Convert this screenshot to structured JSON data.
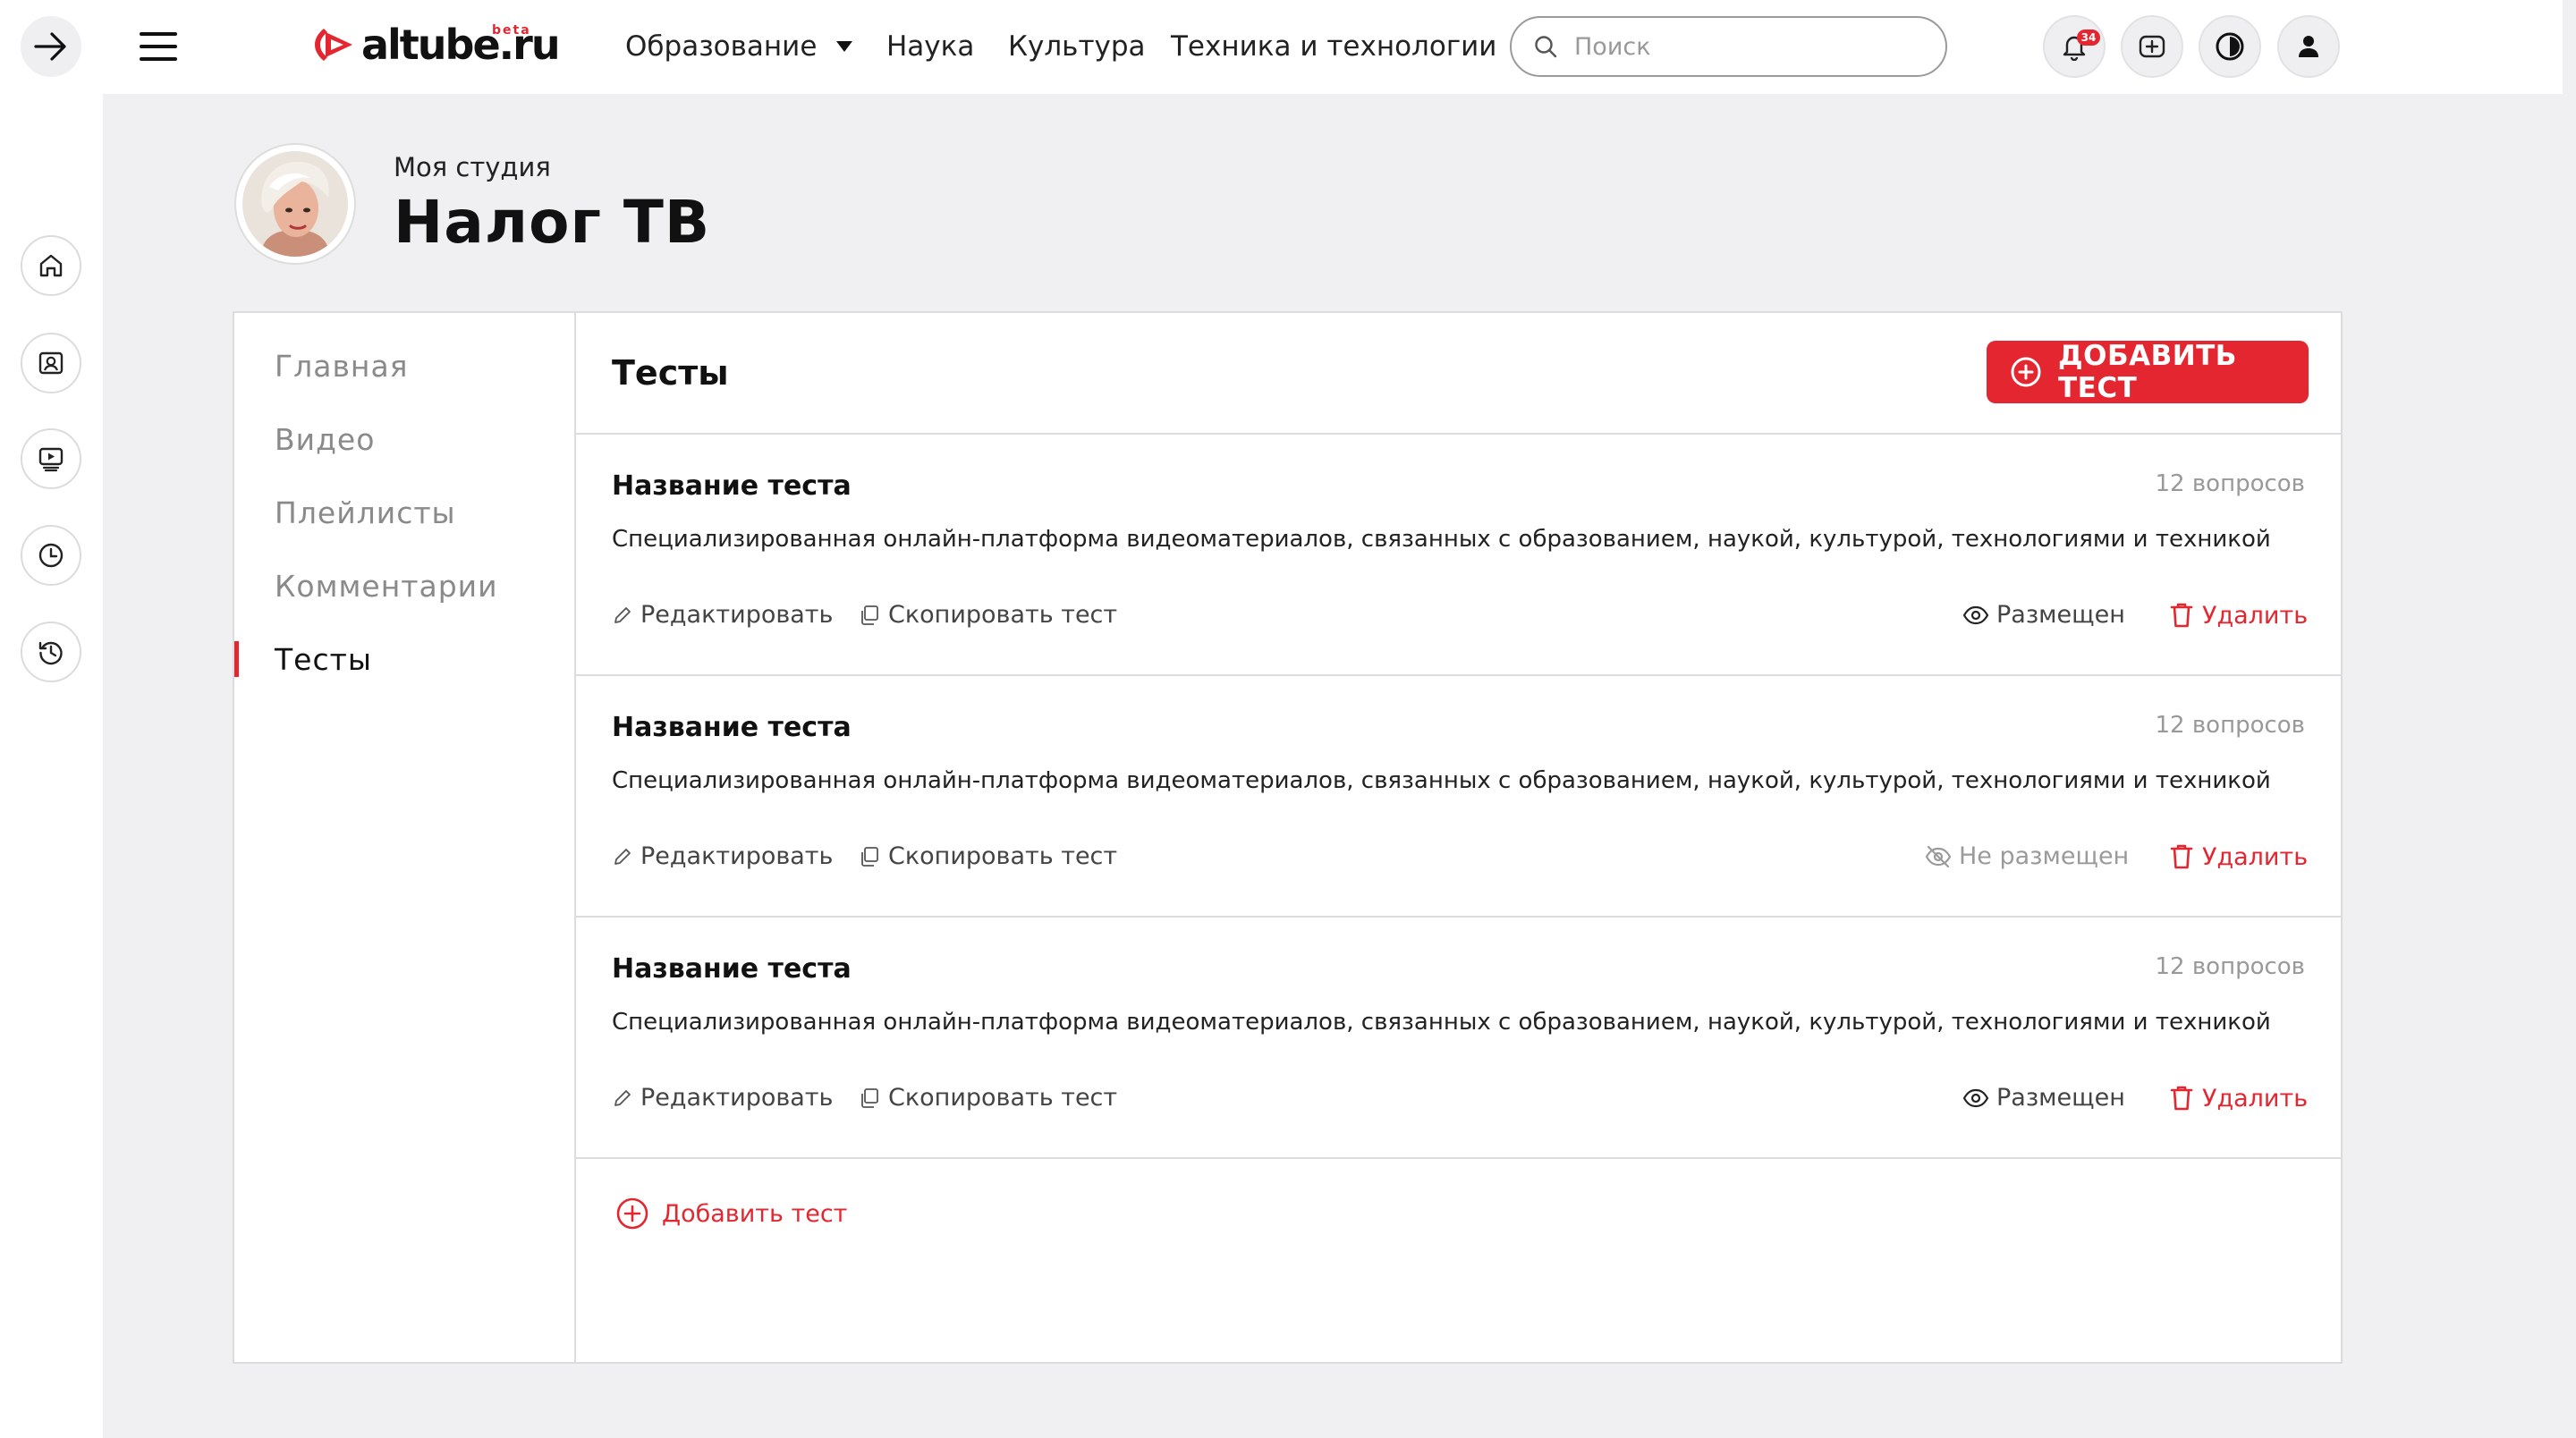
{
  "rail": {
    "icons": [
      "arrow-right-icon",
      "home-icon",
      "profile-icon",
      "video-play-icon",
      "clock-icon",
      "history-icon"
    ]
  },
  "header": {
    "logo_text": "altube.ru",
    "logo_beta": "beta",
    "nav": [
      {
        "label": "Образование"
      },
      {
        "label": "Наука"
      },
      {
        "label": "Культура"
      },
      {
        "label": "Техника и технологии"
      }
    ],
    "search_placeholder": "Поиск",
    "notifications_count": "34"
  },
  "studio": {
    "label": "Моя студия",
    "channel": "Налог ТВ"
  },
  "sidebar": {
    "items": [
      {
        "label": "Главная"
      },
      {
        "label": "Видео"
      },
      {
        "label": "Плейлисты"
      },
      {
        "label": "Комментарии"
      },
      {
        "label": "Тесты"
      }
    ],
    "active_index": 4
  },
  "content": {
    "title": "Тесты",
    "add_button": "ДОБАВИТЬ ТЕСТ",
    "add_link": "Добавить тест",
    "edit_label": "Редактировать",
    "copy_label": "Скопировать тест",
    "delete_label": "Удалить",
    "tests": [
      {
        "name": "Название теста",
        "count": "12 вопросов",
        "description": "Специализированная онлайн-платформа видеоматериалов, связанных с образованием, наукой, культурой, технологиями и техникой",
        "status": "Размещен",
        "published": true
      },
      {
        "name": "Название теста",
        "count": "12 вопросов",
        "description": "Специализированная онлайн-платформа видеоматериалов, связанных с образованием, наукой, культурой, технологиями и техникой",
        "status": "Не размещен",
        "published": false
      },
      {
        "name": "Название теста",
        "count": "12 вопросов",
        "description": "Специализированная онлайн-платформа видеоматериалов, связанных с образованием, наукой, культурой, технологиями и техникой",
        "status": "Размещен",
        "published": true
      }
    ]
  },
  "colors": {
    "accent": "#e3262f",
    "background": "#f0f0f3"
  }
}
